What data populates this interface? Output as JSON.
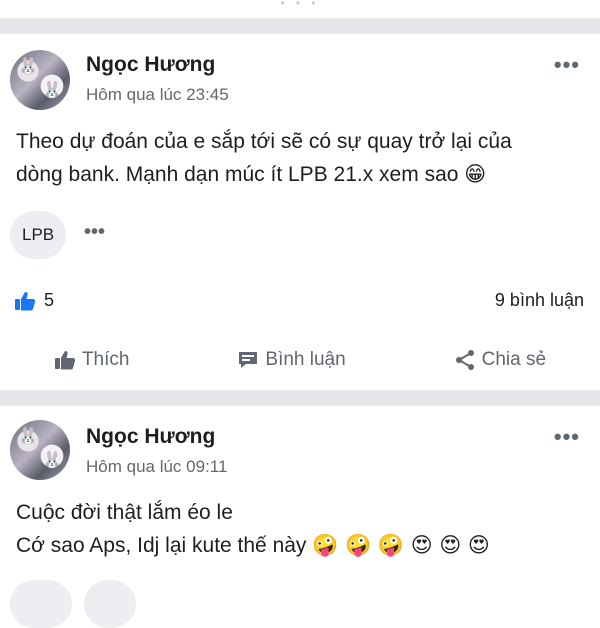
{
  "posts": [
    {
      "author": "Ngọc Hương",
      "time": "Hôm qua lúc 23:45",
      "text_line1": "Theo dự đoán của e sắp tới sẽ có sự quay trở lại của",
      "text_line2": "dòng bank. Mạnh dạn múc ít LPB 21.x xem sao",
      "text_emoji": "😁",
      "tag": "LPB",
      "likes": "5",
      "comments": "9 bình luận",
      "actions": {
        "like": "Thích",
        "comment": "Bình luận",
        "share": "Chia sẻ"
      }
    },
    {
      "author": "Ngọc Hương",
      "time": "Hôm qua lúc 09:11",
      "text_line1": "Cuộc đời thật lắm éo le",
      "text_line2": "Cớ sao Aps, Idj lại kute thế này",
      "text_emoji": "🤪 🤪 🤪 😍 😍 😍"
    }
  ],
  "icons": {
    "more": "more-horizontal-icon",
    "like": "thumbs-up-icon",
    "comment": "comment-bubble-icon",
    "share": "share-icon"
  },
  "colors": {
    "like_blue": "#1877f2",
    "muted": "#65676b",
    "separator": "#e6e7ea"
  }
}
